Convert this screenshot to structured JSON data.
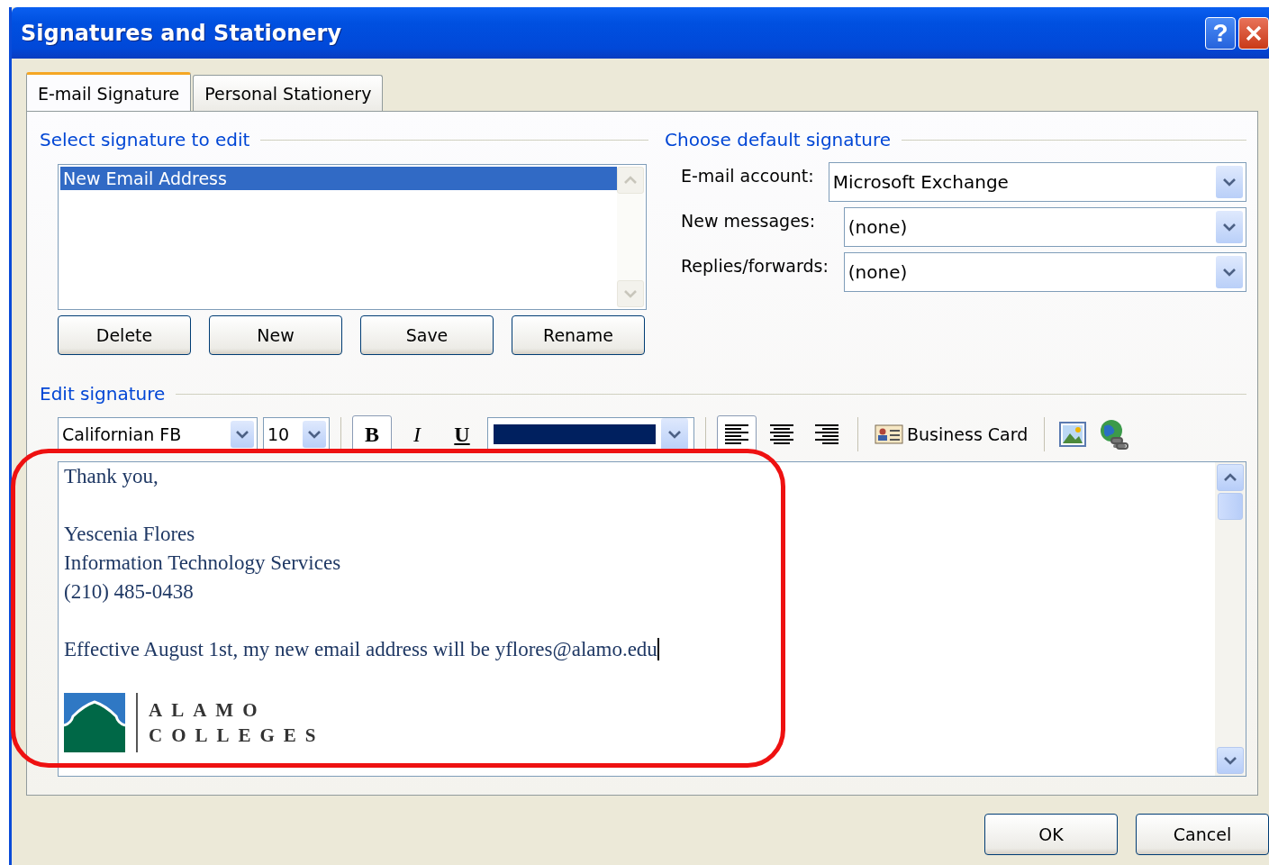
{
  "window": {
    "title": "Signatures and Stationery",
    "help_label": "?"
  },
  "tabs": [
    {
      "label": "E-mail Signature",
      "selected": true
    },
    {
      "label": "Personal Stationery",
      "selected": false
    }
  ],
  "select_section": {
    "heading": "Select signature to edit",
    "signatures": [
      {
        "name": "New Email Address",
        "selected": true
      }
    ],
    "buttons": [
      "Delete",
      "New",
      "Save",
      "Rename"
    ]
  },
  "default_section": {
    "heading": "Choose default signature",
    "fields": [
      {
        "label": "E-mail account:",
        "value": "Microsoft Exchange"
      },
      {
        "label": "New messages:",
        "value": "(none)"
      },
      {
        "label": "Replies/forwards:",
        "value": "(none)"
      }
    ]
  },
  "edit_section": {
    "heading": "Edit signature",
    "toolbar": {
      "font": "Californian FB",
      "size": "10",
      "format_buttons": [
        {
          "kind": "bold",
          "label": "B"
        },
        {
          "kind": "italic",
          "label": "I"
        },
        {
          "kind": "underline",
          "label": "U"
        }
      ],
      "font_color": {
        "color": "#00205f"
      },
      "alignment": [
        {
          "kind": "left",
          "selected": true
        },
        {
          "kind": "center",
          "selected": false
        },
        {
          "kind": "right",
          "selected": false
        }
      ],
      "business_card": "Business Card"
    },
    "editor": {
      "paragraphs": [
        {
          "lines": [
            "Thank you,"
          ]
        },
        {
          "lines": [
            "Yescenia Flores",
            "Information Technology Services",
            "(210) 485-0438"
          ]
        },
        {
          "lines": [
            "Effective August 1st, my new email address will be yflores@alamo.edu"
          ]
        }
      ],
      "logo_lines": [
        "ALAMO",
        "COLLEGES"
      ]
    }
  },
  "dialog_buttons": [
    "OK",
    "Cancel"
  ]
}
